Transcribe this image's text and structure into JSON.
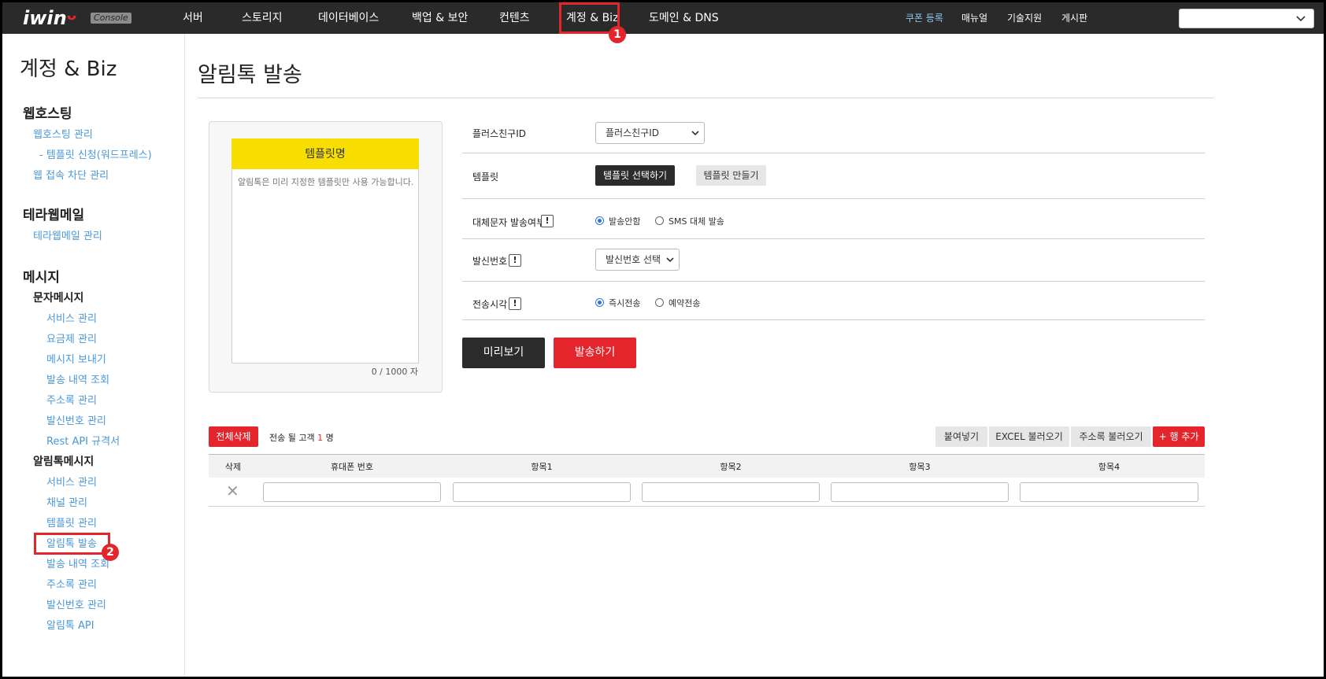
{
  "topnav": {
    "logo": "iwin",
    "logo_mark": "ᴗ",
    "console_badge": "Console",
    "items": [
      "서버",
      "스토리지",
      "데이터베이스",
      "백업 & 보안",
      "컨텐츠",
      "계정 & Biz",
      "도메인 & DNS"
    ],
    "right": [
      "쿠폰 등록",
      "매뉴얼",
      "기술지원",
      "게시판"
    ],
    "select_value": "",
    "accent_color": "#8fc6ee"
  },
  "annotations": {
    "marker1": "1",
    "marker2": "2",
    "color": "#e4262c"
  },
  "sidebar": {
    "title": "계정 & Biz",
    "sec_webhosting": "웹호스팅",
    "webhosting_manage": "웹호스팅 관리",
    "template_wp": "- 템플릿 신청(워드프레스)",
    "web_block": "웹 접속 차단 관리",
    "sec_terraweb": "테라웹메일",
    "terraweb_manage": "테라웹메일 관리",
    "sec_message": "메시지",
    "sub_sms": "문자메시지",
    "sms_items": [
      "서비스 관리",
      "요금제 관리",
      "메시지 보내기",
      "발송 내역 조회",
      "주소록 관리",
      "발신번호 관리",
      "Rest API 규격서"
    ],
    "sub_alimtalk": "알림톡메시지",
    "alim_items": [
      "서비스 관리",
      "채널 관리",
      "템플릿 관리",
      "알림톡 발송",
      "발송 내역 조회",
      "주소록 관리",
      "발신번호 관리",
      "알림톡 API"
    ]
  },
  "main": {
    "title": "알림톡 발송",
    "template_preview": {
      "header": "템플릿명",
      "body": "알림톡은 미리 지정한 템플릿만 사용 가능합니다.",
      "count": "0 / 1000 자",
      "header_color": "#f7de00"
    },
    "form": {
      "plusfriend_label": "플러스친구ID",
      "plusfriend_value": "플러스친구ID",
      "template_label": "템플릿",
      "template_select_btn": "템플릿 선택하기",
      "template_create_btn": "템플릿 만들기",
      "alt_label": "대체문자 발송여부",
      "alt_opt1": "발송안함",
      "alt_opt2": "SMS 대체 발송",
      "sender_label": "발신번호",
      "sender_value": "발신번호 선택",
      "time_label": "전송시각",
      "time_opt1": "즉시전송",
      "time_opt2": "예약전송",
      "help": "!"
    },
    "preview_btn": "미리보기",
    "send_btn": "발송하기",
    "recipients": {
      "delete_all": "전체삭제",
      "prefix": "전송 될 고객",
      "count": "1",
      "suffix": "명",
      "paste": "붙여넣기",
      "excel": "EXCEL 불러오기",
      "addressbook": "주소록 불러오기",
      "add_row": "+ 행 추가",
      "columns": [
        "삭제",
        "휴대폰 번호",
        "항목1",
        "항목2",
        "항목3",
        "항목4"
      ],
      "delete_glyph": "✕"
    }
  }
}
